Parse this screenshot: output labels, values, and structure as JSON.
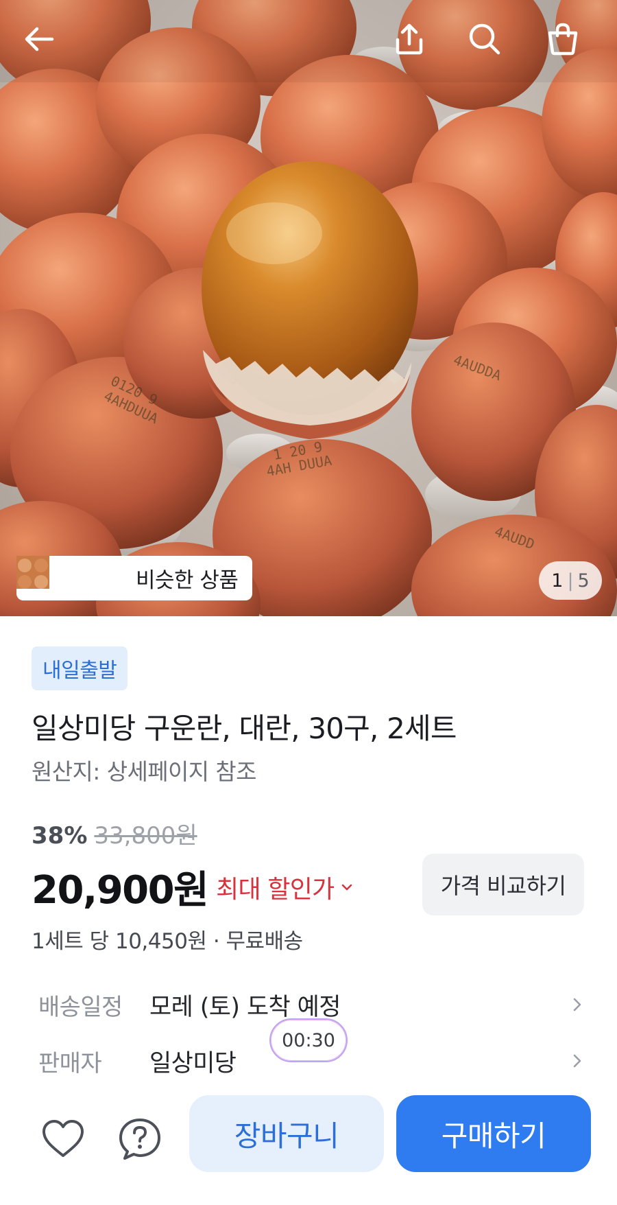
{
  "hero": {
    "image_desc": "photo",
    "similar_label": "비슷한 상품",
    "counter_current": "1",
    "counter_total": "5"
  },
  "topbar": {
    "back_icon": "arrow-left",
    "share_icon": "share",
    "search_icon": "search",
    "cart_icon": "shopping-bag"
  },
  "product": {
    "badge": "내일출발",
    "title": "일상미당 구운란, 대란, 30구, 2세트",
    "origin": "원산지: 상세페이지 참조",
    "discount_rate": "38%",
    "original_price": "33,800원",
    "price": "20,900원",
    "max_discount_label": "최대 할인가",
    "compare_label": "가격 비교하기",
    "unit_price": "1세트 당 10,450원 · 무료배송"
  },
  "info": {
    "delivery_key": "배송일정",
    "delivery_value": "모레 (토) 도착 예정",
    "seller_key": "판매자",
    "seller_value": "일상미당"
  },
  "timer": "00:30",
  "bottom": {
    "cart_label": "장바구니",
    "buy_label": "구매하기"
  },
  "colors": {
    "primary": "#2f7cf0",
    "discount_red": "#d6333d",
    "badge_bg": "#e3eefc"
  }
}
